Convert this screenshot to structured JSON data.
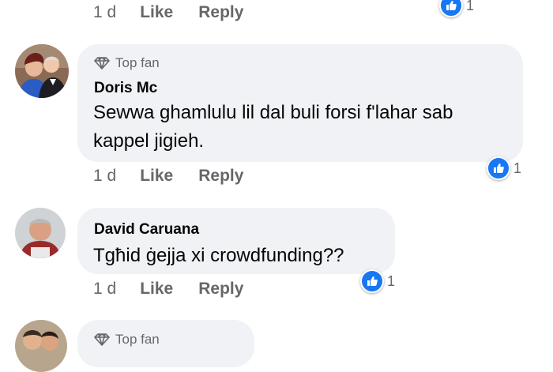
{
  "comments": [
    {
      "actions": {
        "time": "1 d",
        "like": "Like",
        "reply": "Reply"
      },
      "reactions": {
        "count": "1"
      }
    },
    {
      "badge": "Top fan",
      "author": "Doris Mc",
      "text_line1": "Sewwa ghamlulu lil dal buli forsi f'lahar sab",
      "text_line2": "kappel jigieh.",
      "actions": {
        "time": "1 d",
        "like": "Like",
        "reply": "Reply"
      },
      "reactions": {
        "count": "1"
      }
    },
    {
      "author": "David Caruana",
      "text": "Tgħid ġejja xi crowdfunding??",
      "actions": {
        "time": "1 d",
        "like": "Like",
        "reply": "Reply"
      },
      "reactions": {
        "count": "1"
      }
    },
    {
      "badge": "Top fan"
    }
  ],
  "colors": {
    "bubble": "#f0f2f5",
    "meta": "#65676b",
    "like_blue": "#1877f2"
  }
}
